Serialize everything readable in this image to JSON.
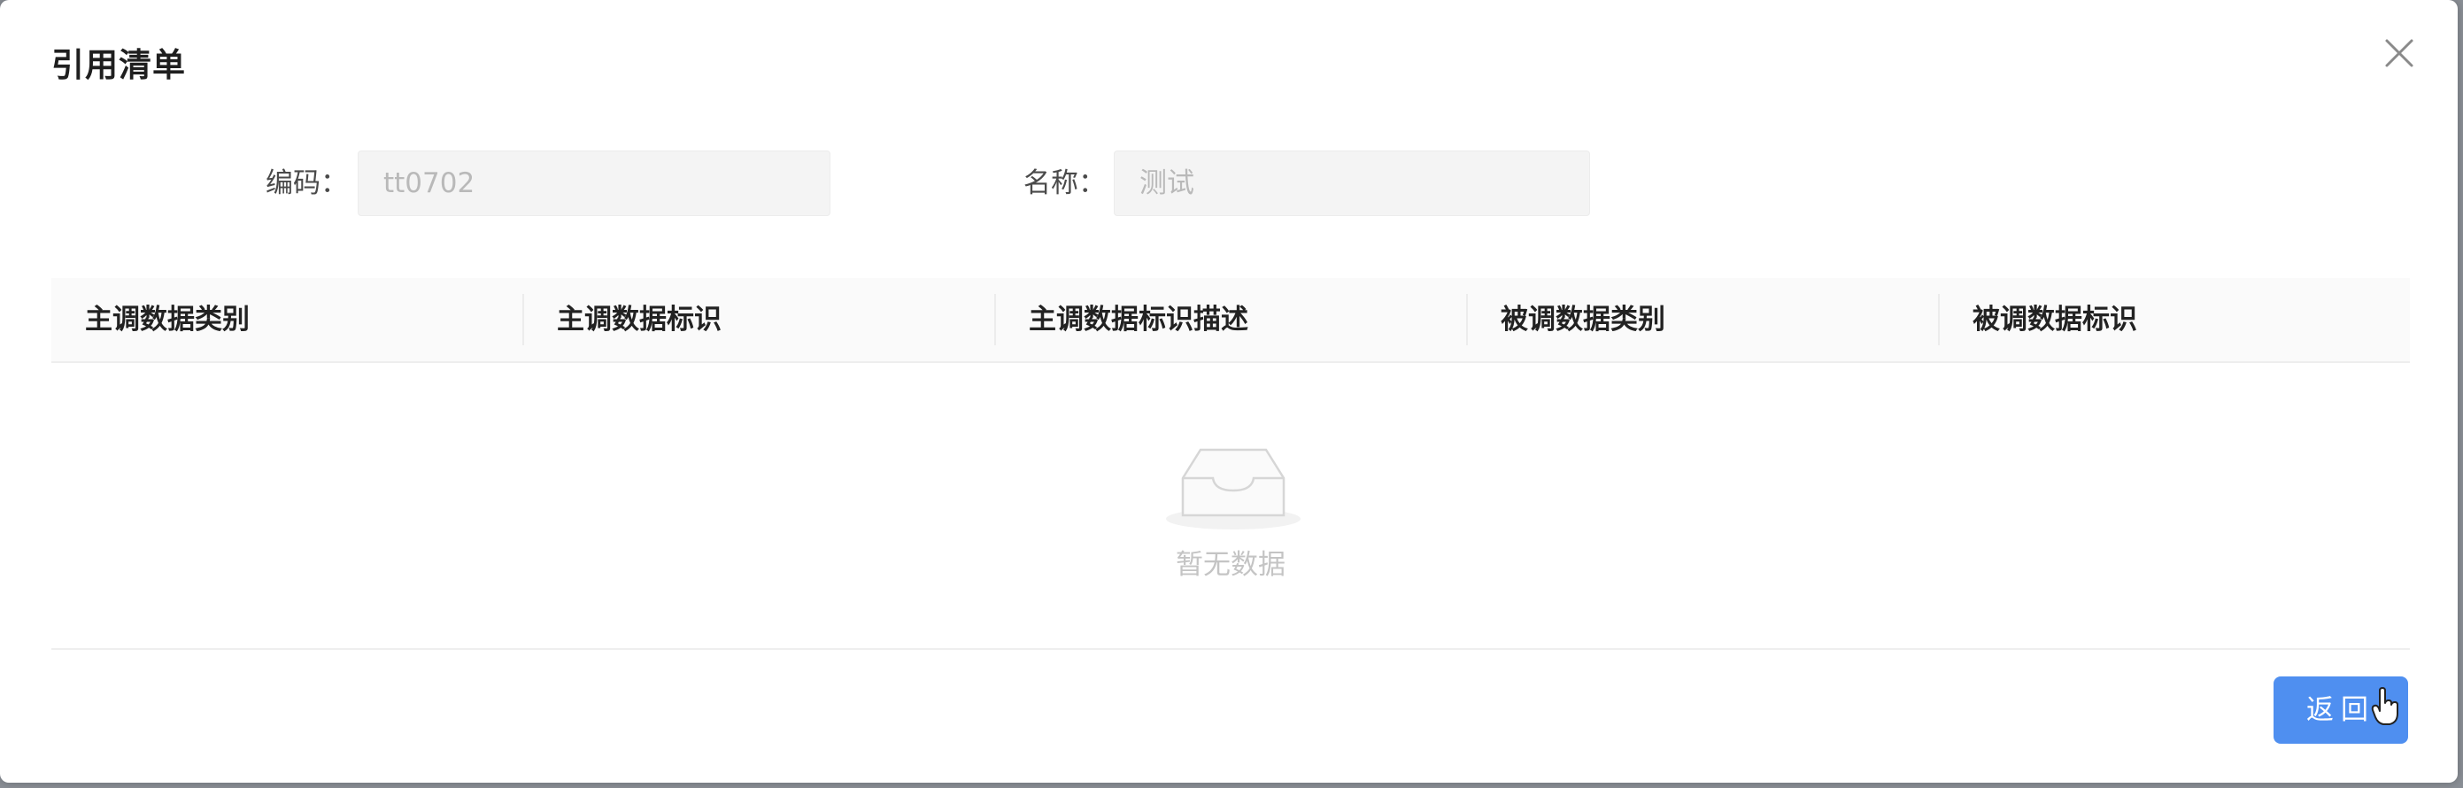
{
  "dialog": {
    "title": "引用清单",
    "close_icon": "close-icon"
  },
  "form": {
    "code_label": "编码：",
    "code_value": "tt0702",
    "name_label": "名称：",
    "name_value": "测试"
  },
  "table": {
    "columns": [
      "主调数据类别",
      "主调数据标识",
      "主调数据标识描述",
      "被调数据类别",
      "被调数据标识"
    ],
    "rows": [],
    "empty_icon": "empty-inbox-icon",
    "empty_text": "暂无数据"
  },
  "footer": {
    "return_label": "返回"
  },
  "colors": {
    "primary": "#4f8ff0",
    "header_bg": "#fafafa",
    "input_bg": "#f4f4f4"
  }
}
